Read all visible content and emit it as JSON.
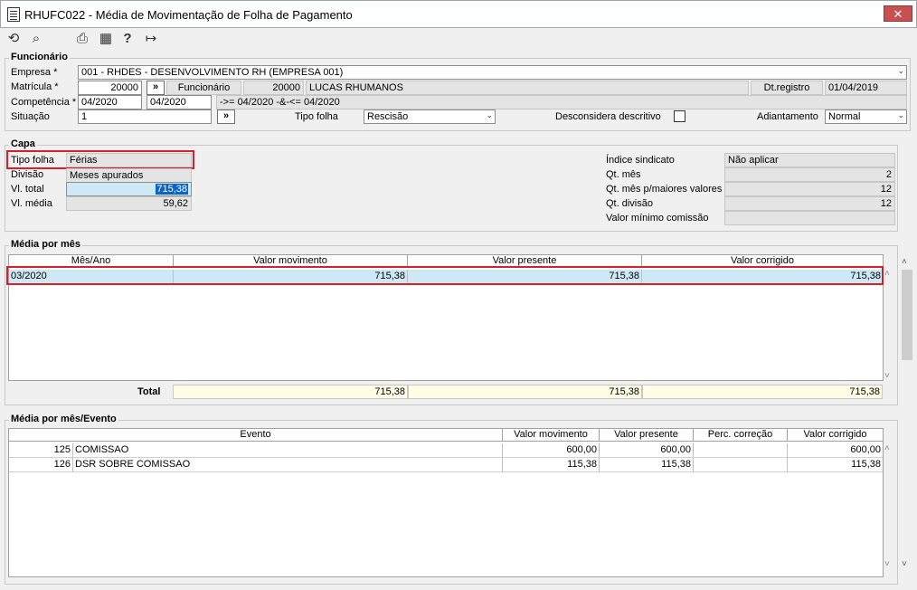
{
  "window": {
    "title": "RHUFC022 - Média de Movimentação de Folha de Pagamento",
    "close": "✕"
  },
  "funcionario": {
    "group_title": "Funcionário",
    "empresa_label": "Empresa *",
    "empresa_value": "001 - RHDES - DESENVOLVIMENTO RH (EMPRESA 001)",
    "matricula_label": "Matrícula *",
    "matricula_value": "20000",
    "arrow_button": "»",
    "funcionario_label": "Funcionário",
    "funcionario_code": "20000",
    "funcionario_name": "LUCAS RHUMANOS",
    "dtregistro_label": "Dt.registro",
    "dtregistro_value": "01/04/2019",
    "competencia_label": "Competência *",
    "competencia_from": "04/2020",
    "competencia_to": "04/2020",
    "competencia_expr": "->= 04/2020 -&-<= 04/2020",
    "situacao_label": "Situação",
    "situacao_value": "1",
    "tipofolha_label": "Tipo folha",
    "tipofolha_value": "Rescisão",
    "desconsidera_label": "Desconsidera descritivo",
    "adiantamento_label": "Adiantamento",
    "adiantamento_value": "Normal"
  },
  "capa": {
    "group_title": "Capa",
    "tipofolha_label": "Tipo folha",
    "tipofolha_value": "Férias",
    "divisao_label": "Divisão",
    "divisao_value": "Meses apurados",
    "vltotal_label": "Vl. total",
    "vltotal_value": "715,38",
    "vlmedia_label": "Vl. média",
    "vlmedia_value": "59,62",
    "indice_label": "Índice sindicato",
    "indice_value": "Não aplicar",
    "qtmes_label": "Qt. mês",
    "qtmes_value": "2",
    "qtmesmaiores_label": "Qt. mês p/maiores valores",
    "qtmesmaiores_value": "12",
    "qtdivisao_label": "Qt. divisão",
    "qtdivisao_value": "12",
    "valorminimo_label": "Valor mínimo comissão",
    "valorminimo_value": ""
  },
  "media_mes": {
    "group_title": "Média por mês",
    "headers": [
      "Mês/Ano",
      "Valor movimento",
      "Valor presente",
      "Valor corrigido"
    ],
    "rows": [
      [
        "03/2020",
        "715,38",
        "715,38",
        "715,38"
      ]
    ],
    "total_label": "Total",
    "totals": [
      "715,38",
      "715,38",
      "715,38"
    ]
  },
  "media_evento": {
    "group_title": "Média por mês/Evento",
    "headers": [
      "Evento",
      "Valor movimento",
      "Valor presente",
      "Perc. correção",
      "Valor corrigido"
    ],
    "rows": [
      [
        "125",
        "COMISSAO",
        "600,00",
        "600,00",
        "",
        "600,00"
      ],
      [
        "126",
        "DSR SOBRE COMISSAO",
        "115,38",
        "115,38",
        "",
        "115,38"
      ]
    ]
  },
  "icons": {
    "undo": "⟲",
    "search": "⌕",
    "print": "⎙",
    "grid": "▦",
    "help": "?",
    "exit": "↦",
    "chevron": "⌄",
    "scroll_up": "˄",
    "scroll_down": "˅"
  }
}
